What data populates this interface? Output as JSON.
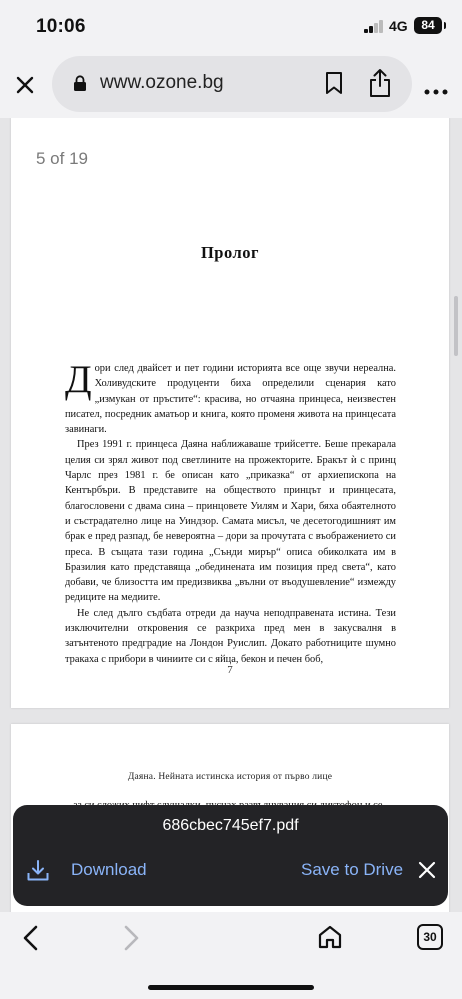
{
  "status_bar": {
    "time": "10:06",
    "network": "4G",
    "battery": "84"
  },
  "browser": {
    "url": "www.ozone.bg"
  },
  "viewer": {
    "page_counter": "5 of 19",
    "page1": {
      "title": "Пролог",
      "drop_cap": "Д",
      "paragraphs": [
        "ори след двайсет и пет години историята все още звучи нереална. Холивудските продуценти биха определили сценария като „измукан от пръстите“: красива, но отчаяна принцеса, неизвестен писател, посредник аматьор и книга, която променя живота на принцесата завинаги.",
        "През 1991 г. принцеса Даяна наближаваше трийсетте. Беше прекарала целия си зрял живот под светлините на прожекторите. Бракът ѝ с принц Чарлс през 1981 г. бе описан като „приказка“ от архиепископа на Кентърбъри. В представите на обществото принцът и принцесата, благословени с двама сина – принцовете Уилям и Хари, бяха обаятелното и състрадателно лице на Уиндзор. Самата мисъл, че десетогодишният им брак е пред разпад, бе невероятна – дори за прочутата с въображението си преса. В същата тази година „Сънди мирър“ описа обиколката им в Бразилия като представяща „обединената им позиция пред света“, като добави, че близостта им предизвиква „вълни от въодушевление“ измежду редиците на медиите.",
        "Не след дълго съдбата отреди да науча неподправената истина. Тези изключителни откровения се разкриха пред мен в закусвалня в затънтеното предградие на Лондон Руислип. Докато работниците шумно тракаха с прибори в чиниите си с яйца, бекон и печен боб,"
      ],
      "page_number": "7"
    },
    "page2": {
      "running_header": "Даяна. Нейната истинска история от първо лице",
      "first_line": "аз си сложих чифт слушалки, пуснах развълнувания си диктофон и се"
    }
  },
  "download_sheet": {
    "file_name": "686cbec745ef7.pdf",
    "download_label": "Download",
    "save_to_drive_label": "Save to Drive"
  },
  "bottom_bar": {
    "tab_count": "30"
  }
}
